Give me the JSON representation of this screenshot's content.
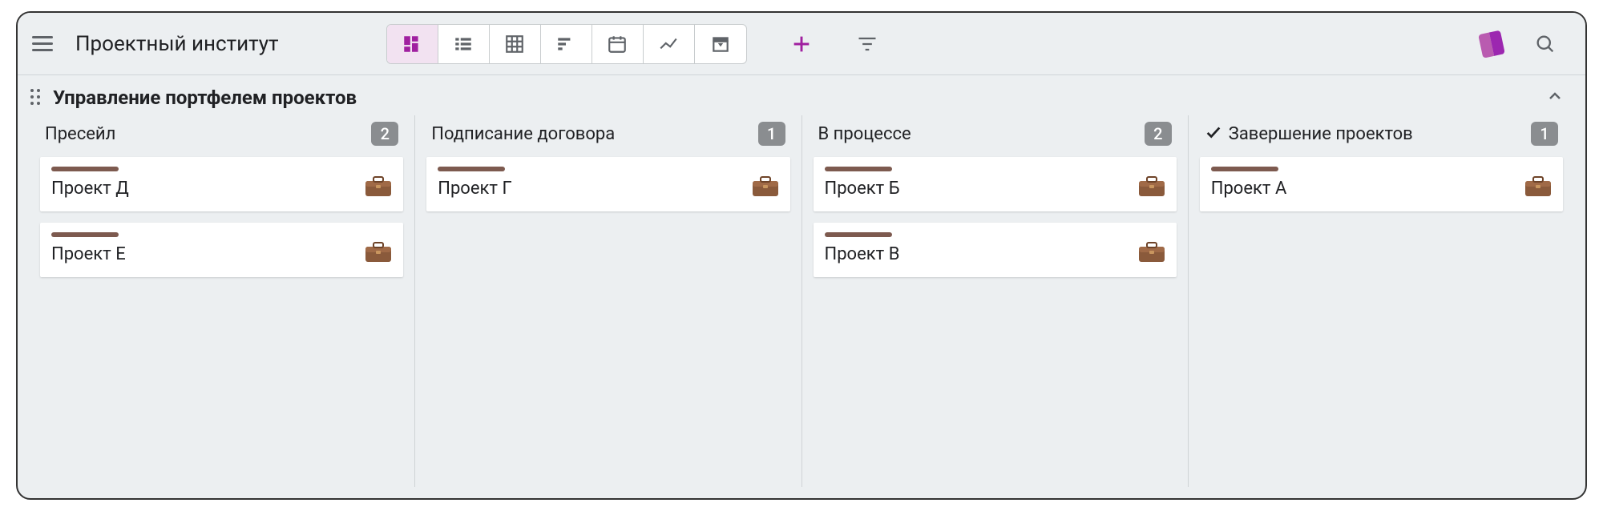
{
  "header": {
    "title": "Проектный институт"
  },
  "board": {
    "title": "Управление портфелем проектов"
  },
  "columns": [
    {
      "title": "Пресейл",
      "count": "2",
      "done": false,
      "cards": [
        {
          "name": "Проект Д"
        },
        {
          "name": "Проект Е"
        }
      ]
    },
    {
      "title": "Подписание договора",
      "count": "1",
      "done": false,
      "cards": [
        {
          "name": "Проект Г"
        }
      ]
    },
    {
      "title": "В процессе",
      "count": "2",
      "done": false,
      "cards": [
        {
          "name": "Проект Б"
        },
        {
          "name": "Проект В"
        }
      ]
    },
    {
      "title": "Завершение проектов",
      "count": "1",
      "done": true,
      "cards": [
        {
          "name": "Проект А"
        }
      ]
    }
  ]
}
